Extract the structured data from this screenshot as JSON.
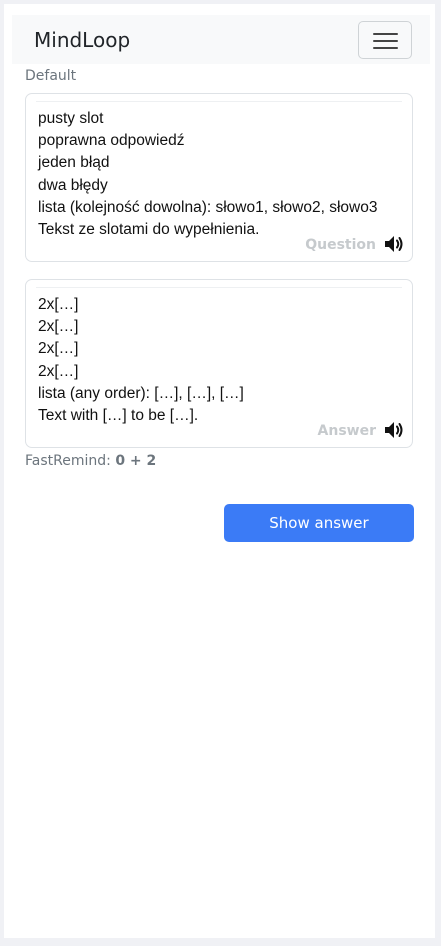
{
  "navbar": {
    "brand": "MindLoop",
    "menu_icon": "hamburger-menu-icon"
  },
  "deck": {
    "name": "Default"
  },
  "question_card": {
    "lines": [
      "pusty slot",
      "poprawna odpowiedź",
      "jeden błąd",
      "dwa błędy",
      "lista (kolejność dowolna): słowo1, słowo2, słowo3",
      "Tekst ze slotami do wypełnienia."
    ],
    "label": "Question",
    "speaker_icon": "speaker-icon"
  },
  "answer_card": {
    "lines": [
      "2x[…]",
      "2x[…]",
      "2x[…]",
      "2x[…]",
      "lista (any order): […], […], […]",
      "Text with […] to be […]."
    ],
    "label": "Answer",
    "speaker_icon": "speaker-icon"
  },
  "fastremind": {
    "label": "FastRemind:",
    "value": "0 + 2"
  },
  "actions": {
    "show_answer": "Show answer",
    "primary_color": "#3b7bf6"
  }
}
